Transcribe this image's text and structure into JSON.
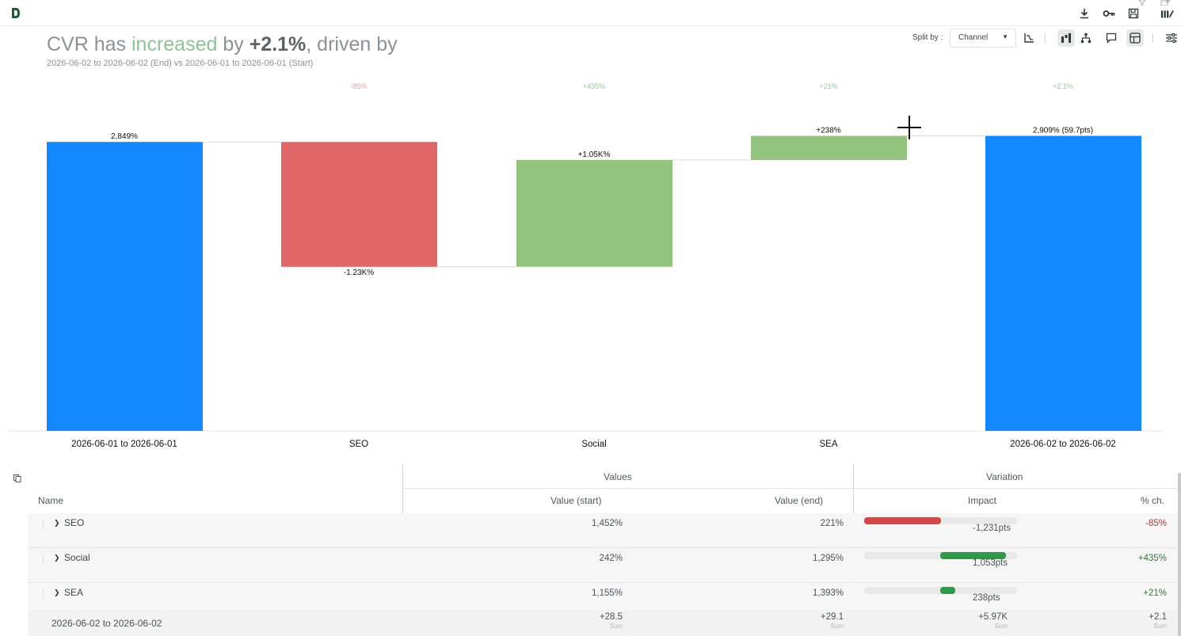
{
  "app": {
    "logo_letter": "D"
  },
  "toolbar_icons": [
    "download-icon",
    "key-icon",
    "save-icon",
    "library-edit-icon"
  ],
  "headline": {
    "prefix": "CVR has ",
    "direction": "increased",
    "mid": " by ",
    "change": "+2.1%",
    "suffix": ", driven by"
  },
  "subtitle": "2026-06-02 to 2026-06-02 (End) vs 2026-06-01 to 2026-06-01 (Start)",
  "controls": {
    "split_label": "Split by :",
    "split_value": "Channel"
  },
  "colors": {
    "total_bar": "#1188ff",
    "negative": "#e06666",
    "positive": "#93c47d",
    "negative_text": "#e8a0a0",
    "positive_text": "#93c79a",
    "impact_neg": "#d94545",
    "impact_pos": "#2e9b45"
  },
  "chart_data": {
    "type": "bar",
    "subtype": "waterfall",
    "categories": [
      "2026-06-01 to 2026-06-01",
      "SEO",
      "Social",
      "SEA",
      "2026-06-02 to 2026-06-02"
    ],
    "kinds": [
      "total",
      "delta",
      "delta",
      "delta",
      "total"
    ],
    "values": [
      2849,
      -1231,
      1053,
      238,
      2909
    ],
    "value_labels": [
      "2,849%",
      "-1.23K%",
      "+1.05K%",
      "+238%",
      "2,909% (59.7pts)"
    ],
    "pct_labels": [
      "",
      "-85%",
      "+435%",
      "+21%",
      "+2.1%"
    ],
    "ylim": [
      0,
      2960
    ],
    "grid": false
  },
  "table": {
    "group_headers": {
      "values": "Values",
      "variation": "Variation"
    },
    "columns": {
      "name": "Name",
      "start": "Value (start)",
      "end": "Value (end)",
      "impact": "Impact",
      "pct": "% ch."
    },
    "rows": [
      {
        "name": "SEO",
        "start": "1,452%",
        "end": "221%",
        "impact": "-1,231pts",
        "pct": "-85%",
        "impact_share": -0.5
      },
      {
        "name": "Social",
        "start": "242%",
        "end": "1,295%",
        "impact": "1,053pts",
        "pct": "+435%",
        "impact_share": 0.43
      },
      {
        "name": "SEA",
        "start": "1,155%",
        "end": "1,393%",
        "impact": "238pts",
        "pct": "+21%",
        "impact_share": 0.1
      }
    ],
    "footer": {
      "name": "2026-06-02 to 2026-06-02",
      "start": "+28.5",
      "end": "+29.1",
      "impact": "+5.97K",
      "pct": "+2.1",
      "agg": "Sum"
    }
  }
}
